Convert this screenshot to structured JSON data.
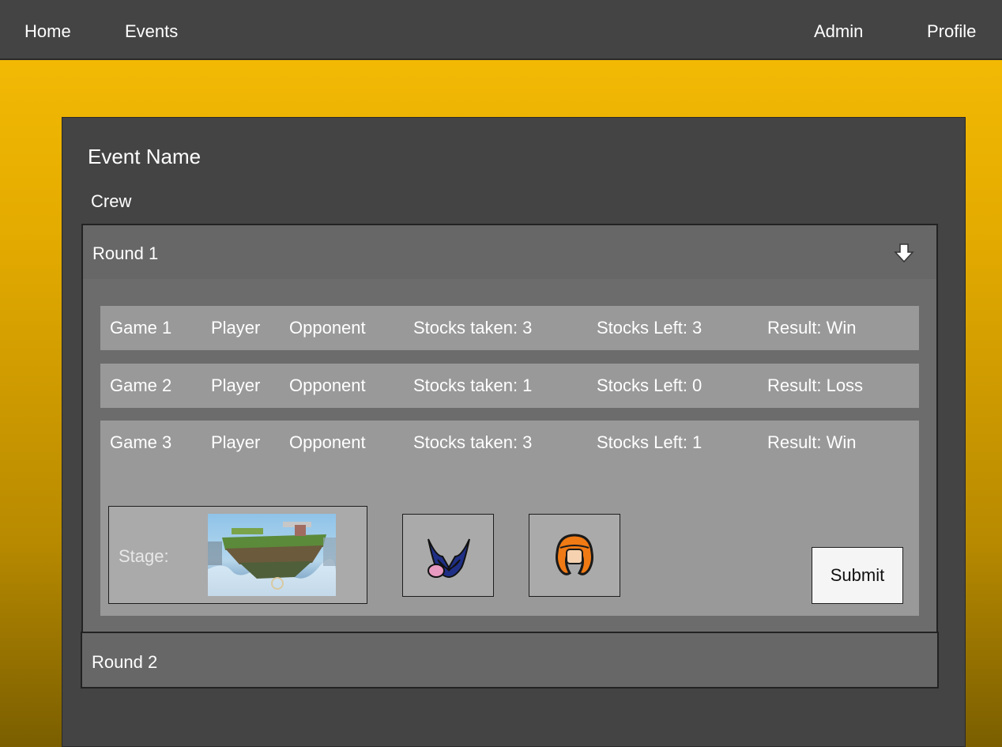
{
  "nav": {
    "home": "Home",
    "events": "Events",
    "admin": "Admin",
    "profile": "Profile"
  },
  "event": {
    "name": "Event Name",
    "crew": "Crew"
  },
  "rounds": [
    {
      "label": "Round 1",
      "expanded": true,
      "games": [
        {
          "game": "Game 1",
          "player": "Player",
          "opponent": "Opponent",
          "stocks_taken": "Stocks taken: 3",
          "stocks_left": "Stocks Left: 3",
          "result": "Result: Win"
        },
        {
          "game": "Game 2",
          "player": "Player",
          "opponent": "Opponent",
          "stocks_taken": "Stocks taken: 1",
          "stocks_left": "Stocks Left: 0",
          "result": "Result: Loss"
        },
        {
          "game": "Game 3",
          "player": "Player",
          "opponent": "Opponent",
          "stocks_taken": "Stocks taken: 3",
          "stocks_left": "Stocks Left: 1",
          "result": "Result: Win"
        }
      ],
      "stage_label": "Stage:",
      "submit_label": "Submit"
    },
    {
      "label": "Round 2",
      "expanded": false
    }
  ],
  "icons": {
    "expand": "arrow-down-icon",
    "stage": "stage-thumbnail",
    "player_character": "meta-knight-icon",
    "opponent_character": "inkling-icon"
  },
  "colors": {
    "navbar": "#444444",
    "background_top": "#f2b904",
    "background_bottom": "#7a5e00",
    "panel": "#444444",
    "round_header": "#676767",
    "game_row": "#999999"
  }
}
